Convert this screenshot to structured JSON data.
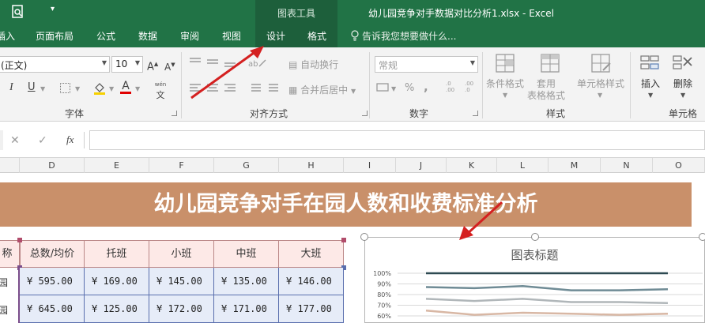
{
  "window": {
    "title": "幼儿园竞争对手数据对比分析1.xlsx - Excel",
    "context_tab_group": "图表工具",
    "quick_access_more": "▾"
  },
  "tabs": [
    {
      "label": "插入"
    },
    {
      "label": "页面布局"
    },
    {
      "label": "公式"
    },
    {
      "label": "数据"
    },
    {
      "label": "审阅"
    },
    {
      "label": "视图"
    },
    {
      "label": "设计"
    },
    {
      "label": "格式"
    }
  ],
  "tell_me": "告诉我您想要做什么...",
  "ribbon": {
    "font_name": "(正文)",
    "font_size": "10",
    "grow_font": "A",
    "shrink_font": "A",
    "italic": "I",
    "underline": "U",
    "phonetic": "wén",
    "phonetic_sub": "文",
    "font_color_glyph": "A",
    "wrap_text": "自动换行",
    "merge_center": "合并后居中",
    "number_format": "常规",
    "percent": "%",
    "comma": ",",
    "inc_decimal": ".0 .00",
    "dec_decimal": ".00 .0",
    "conditional_format": "条件格式",
    "format_as_table_line1": "套用",
    "format_as_table_line2": "表格格式",
    "cell_styles": "单元格样式",
    "insert": "插入",
    "delete": "删除",
    "groups": {
      "font": "字体",
      "alignment": "对齐方式",
      "number": "数字",
      "styles": "样式",
      "cells": "单元格"
    }
  },
  "formula_bar": {
    "cancel": "✕",
    "enter": "✓",
    "fx": "fx",
    "value": ""
  },
  "columns": [
    "D",
    "E",
    "F",
    "G",
    "H",
    "I",
    "J",
    "K",
    "L",
    "M",
    "N",
    "O"
  ],
  "sheet": {
    "banner": "幼儿园竞争对手在园人数和收费标准分析",
    "table_header_prefix": "称",
    "table_headers": [
      "总数/均价",
      "托班",
      "小班",
      "中班",
      "大班"
    ],
    "row_labels": [
      "园",
      "园"
    ],
    "rows": [
      [
        "¥ 595.00",
        "¥ 169.00",
        "¥ 145.00",
        "¥ 135.00",
        "¥ 146.00"
      ],
      [
        "¥ 645.00",
        "¥ 125.00",
        "¥ 172.00",
        "¥ 171.00",
        "¥ 177.00"
      ]
    ]
  },
  "chart_data": {
    "type": "line",
    "title": "图表标题",
    "y_tick_labels": [
      "100%",
      "90%",
      "80%",
      "70%",
      "60%"
    ],
    "ylim": [
      0.6,
      1.0
    ],
    "x": [
      1,
      2,
      3,
      4,
      5,
      6
    ],
    "series": [
      {
        "color": "#2e4a52",
        "values": [
          1.0,
          1.0,
          1.0,
          1.0,
          1.0,
          1.0
        ]
      },
      {
        "color": "#6f8b95",
        "values": [
          0.87,
          0.86,
          0.88,
          0.84,
          0.84,
          0.85
        ]
      },
      {
        "color": "#b0b6b9",
        "values": [
          0.76,
          0.74,
          0.76,
          0.73,
          0.73,
          0.72
        ]
      },
      {
        "color": "#d8b7a4",
        "values": [
          0.65,
          0.61,
          0.63,
          0.62,
          0.61,
          0.62
        ]
      }
    ],
    "grid": true
  }
}
